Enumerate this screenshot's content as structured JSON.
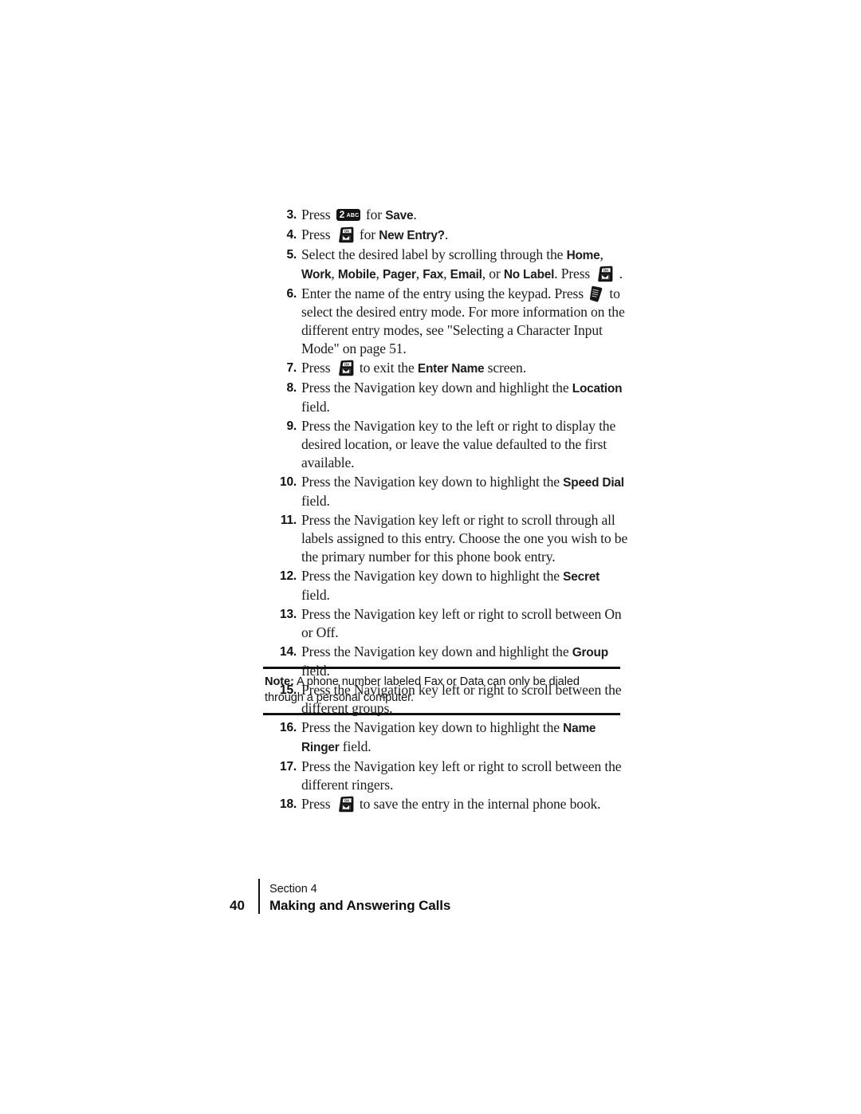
{
  "document": {
    "type": "user-manual-page",
    "body_font_style": "serif",
    "accent_color": "#111111",
    "page_background": "#ffffff"
  },
  "icons": {
    "key2_number": "2",
    "key2_letters": "ABC",
    "ok_key_label": "OK",
    "mode_key_label": "mode"
  },
  "steps": [
    {
      "number": "3.",
      "parts": [
        {
          "type": "text",
          "value": "Press "
        },
        {
          "type": "icon",
          "value": "key2-icon"
        },
        {
          "type": "text",
          "value": " for "
        },
        {
          "type": "bold",
          "value": "Save"
        },
        {
          "type": "text",
          "value": "."
        }
      ],
      "plain": "Press 2ABC for Save."
    },
    {
      "number": "4.",
      "parts": [
        {
          "type": "text",
          "value": "Press "
        },
        {
          "type": "icon",
          "value": "ok-key-icon"
        },
        {
          "type": "text",
          "value": " for "
        },
        {
          "type": "bold",
          "value": "New Entry?"
        },
        {
          "type": "text",
          "value": "."
        }
      ],
      "plain": "Press [OK key] for New Entry?."
    },
    {
      "number": "5.",
      "parts": [
        {
          "type": "text",
          "value": "Select the desired label by scrolling through the "
        },
        {
          "type": "bold",
          "value": "Home"
        },
        {
          "type": "text",
          "value": ", "
        },
        {
          "type": "bold",
          "value": "Work"
        },
        {
          "type": "text",
          "value": ", "
        },
        {
          "type": "bold",
          "value": "Mobile"
        },
        {
          "type": "text",
          "value": ", "
        },
        {
          "type": "bold",
          "value": "Pager"
        },
        {
          "type": "text",
          "value": ", "
        },
        {
          "type": "bold",
          "value": "Fax"
        },
        {
          "type": "text",
          "value": ", "
        },
        {
          "type": "bold",
          "value": "Email"
        },
        {
          "type": "text",
          "value": ", or "
        },
        {
          "type": "bold",
          "value": "No Label"
        },
        {
          "type": "text",
          "value": ". Press "
        },
        {
          "type": "icon",
          "value": "ok-key-icon"
        },
        {
          "type": "text",
          "value": " ."
        }
      ],
      "plain": "Select the desired label by scrolling through the Home, Work, Mobile, Pager, Fax, Email, or No Label. Press [OK key]."
    },
    {
      "number": "6.",
      "parts": [
        {
          "type": "text",
          "value": "Enter the name of the entry using the keypad. Press "
        },
        {
          "type": "icon",
          "value": "mode-key-icon"
        },
        {
          "type": "text",
          "value": " to select the desired entry mode. For more information on the different entry modes, see \"Selecting a Character Input Mode\" on page 51."
        }
      ],
      "plain": "Enter the name of the entry using the keypad. Press [mode key] to select the desired entry mode. For more information on the different entry modes, see \"Selecting a Character Input Mode\" on page 51."
    },
    {
      "number": "7.",
      "parts": [
        {
          "type": "text",
          "value": "Press "
        },
        {
          "type": "icon",
          "value": "ok-key-icon"
        },
        {
          "type": "text",
          "value": " to exit the "
        },
        {
          "type": "bold",
          "value": "Enter Name"
        },
        {
          "type": "text",
          "value": " screen."
        }
      ],
      "plain": "Press [OK key] to exit the Enter Name screen."
    },
    {
      "number": "8.",
      "parts": [
        {
          "type": "text",
          "value": "Press the Navigation key down and highlight the "
        },
        {
          "type": "bold",
          "value": "Location"
        },
        {
          "type": "text",
          "value": " field."
        }
      ],
      "plain": "Press the Navigation key down and highlight the Location field."
    },
    {
      "number": "9.",
      "parts": [
        {
          "type": "text",
          "value": "Press the Navigation key to the left or right to display the desired location, or leave the value defaulted to the first available."
        }
      ],
      "plain": "Press the Navigation key to the left or right to display the desired location, or leave the value defaulted to the first available."
    },
    {
      "number": "10.",
      "parts": [
        {
          "type": "text",
          "value": "Press the Navigation key down to highlight the "
        },
        {
          "type": "bold",
          "value": "Speed Dial"
        },
        {
          "type": "text",
          "value": " field."
        }
      ],
      "plain": "Press the Navigation key down to highlight the Speed Dial field."
    },
    {
      "number": "11.",
      "parts": [
        {
          "type": "text",
          "value": "Press the Navigation key left or right to scroll through all labels assigned to this entry. Choose the one you wish to be the primary number for this phone book entry."
        }
      ],
      "plain": "Press the Navigation key left or right to scroll through all labels assigned to this entry. Choose the one you wish to be the primary number for this phone book entry."
    },
    {
      "number": "12.",
      "parts": [
        {
          "type": "text",
          "value": "Press the Navigation key down to highlight the "
        },
        {
          "type": "bold",
          "value": "Secret"
        },
        {
          "type": "text",
          "value": " field."
        }
      ],
      "plain": "Press the Navigation key down to highlight the Secret field."
    },
    {
      "number": "13.",
      "parts": [
        {
          "type": "text",
          "value": "Press the Navigation key left or right to scroll between On or Off."
        }
      ],
      "plain": "Press the Navigation key left or right to scroll between On or Off."
    },
    {
      "number": "14.",
      "parts": [
        {
          "type": "text",
          "value": "Press the Navigation key down and highlight the "
        },
        {
          "type": "bold",
          "value": "Group"
        },
        {
          "type": "text",
          "value": " field."
        }
      ],
      "plain": "Press the Navigation key down and highlight the Group field."
    },
    {
      "number": "15.",
      "parts": [
        {
          "type": "text",
          "value": "Press the Navigation key left or right to scroll between the different groups."
        }
      ],
      "plain": "Press the Navigation key left or right to scroll between the different groups."
    },
    {
      "number": "16.",
      "parts": [
        {
          "type": "text",
          "value": "Press the Navigation key down to highlight the "
        },
        {
          "type": "bold",
          "value": "Name Ringer"
        },
        {
          "type": "text",
          "value": " field."
        }
      ],
      "plain": "Press the Navigation key down to highlight the Name Ringer field."
    },
    {
      "number": "17.",
      "parts": [
        {
          "type": "text",
          "value": "Press the Navigation key left or right to scroll between the different ringers."
        }
      ],
      "plain": "Press the Navigation key left or right to scroll between the different ringers."
    },
    {
      "number": "18.",
      "parts": [
        {
          "type": "text",
          "value": "Press "
        },
        {
          "type": "icon",
          "value": "ok-key-icon"
        },
        {
          "type": "text",
          "value": " to save the entry in the internal phone book."
        }
      ],
      "plain": "Press [OK key] to save the entry in the internal phone book."
    }
  ],
  "note": {
    "label": "Note:",
    "text": " A phone number labeled Fax or Data can only be dialed through a personal computer."
  },
  "footer": {
    "page_number": "40",
    "section": "Section 4",
    "title": "Making and Answering Calls"
  }
}
